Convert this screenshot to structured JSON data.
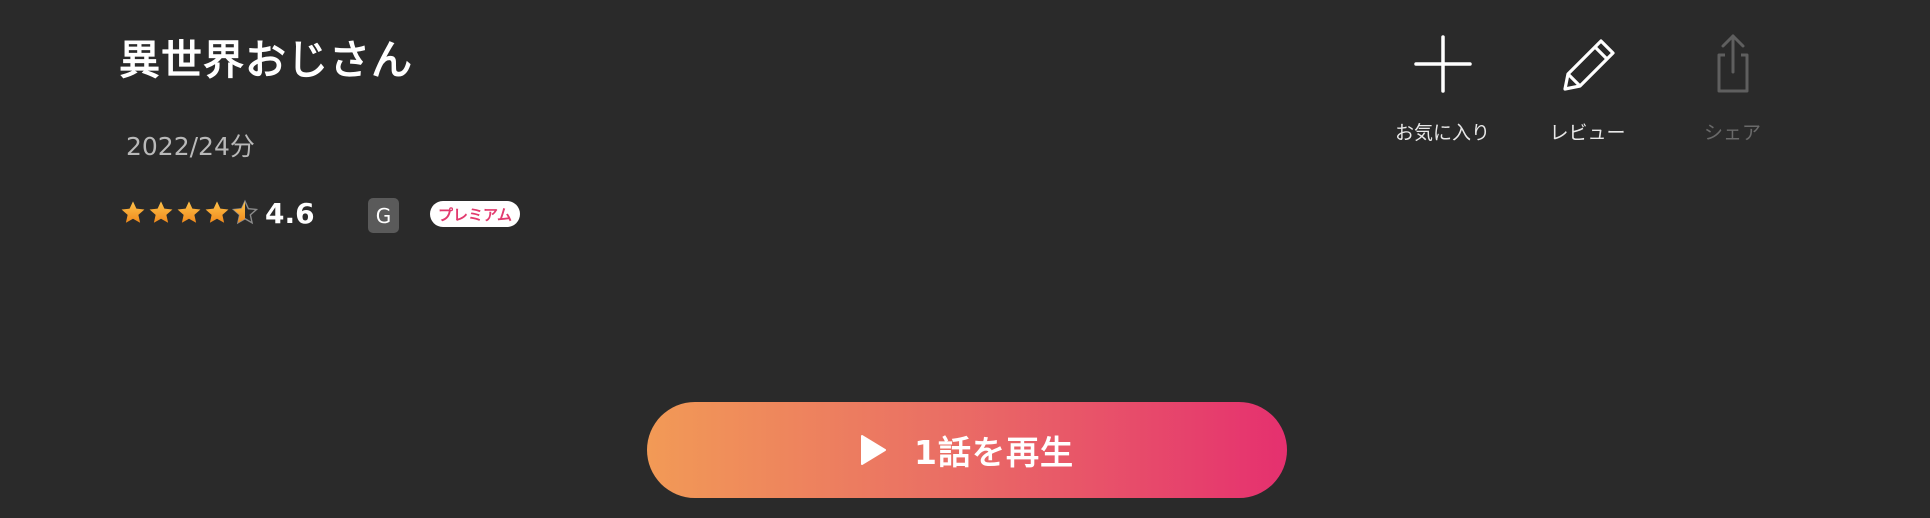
{
  "content": {
    "title": "異世界おじさん",
    "meta": "2022/24分"
  },
  "rating": {
    "value": "4.6",
    "stars_filled": 4.5,
    "stars_total": 5,
    "star_color": "#f7a733"
  },
  "badges": {
    "age": "G",
    "premium": "プレミアム"
  },
  "actions": {
    "favorite": {
      "label": "お気に入り",
      "icon": "plus-icon"
    },
    "review": {
      "label": "レビュー",
      "icon": "pencil-icon"
    },
    "share": {
      "label": "シェア",
      "icon": "share-icon",
      "disabled": true
    }
  },
  "play": {
    "label": "1話を再生",
    "icon": "play-icon"
  },
  "colors": {
    "background": "#2a2a2a",
    "gradient_start": "#f29a56",
    "gradient_end": "#e5306f"
  }
}
